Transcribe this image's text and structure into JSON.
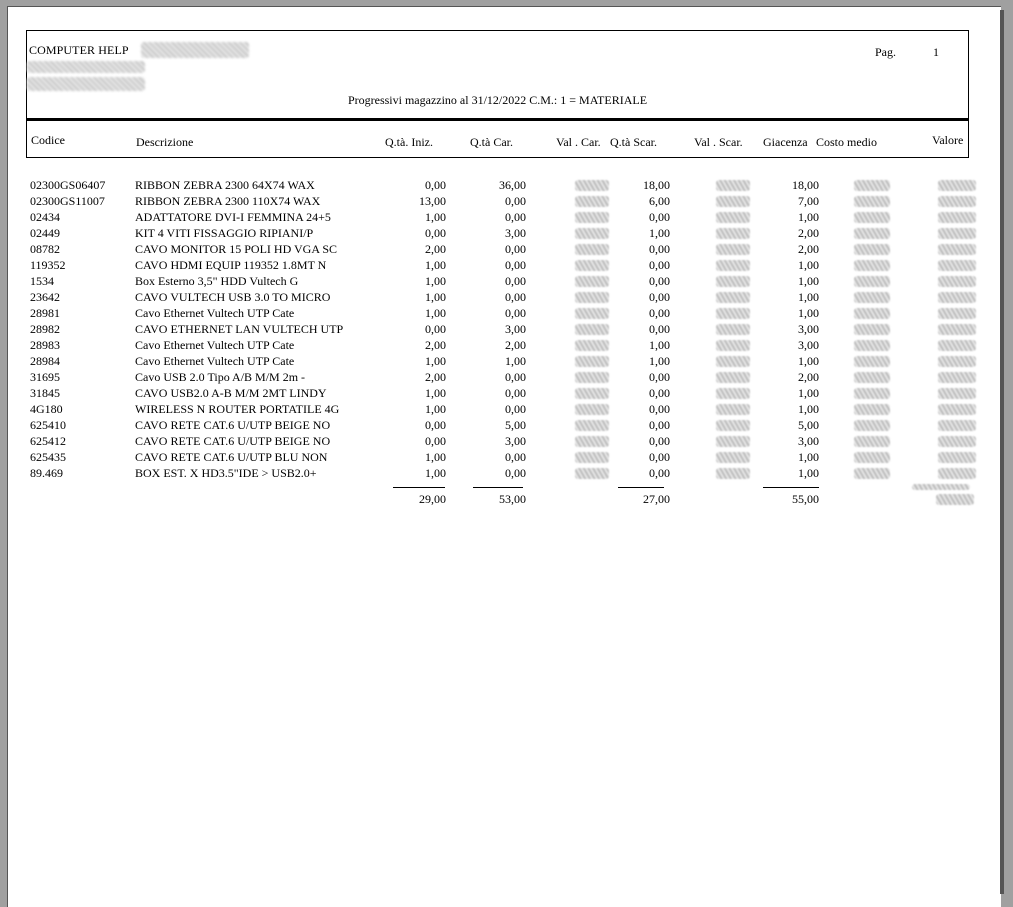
{
  "header": {
    "company": "COMPUTER HELP",
    "page_label": "Pag.",
    "page_number": "1",
    "title": "Progressivi magazzino al 31/12/2022 C.M.: 1 = MATERIALE"
  },
  "columns": {
    "codice": "Codice",
    "descrizione": "Descrizione",
    "qta_iniz": "Q.tà. Iniz.",
    "qta_car": "Q.tà Car.",
    "val_car": "Val . Car.",
    "qta_scar": "Q.tà Scar.",
    "val_scar": "Val . Scar.",
    "giacenza": "Giacenza",
    "costo_medio": "Costo medio",
    "valore": "Valore"
  },
  "rows": [
    {
      "codice": "02300GS06407",
      "descrizione": "RIBBON ZEBRA 2300 64X74 WAX",
      "qta_iniz": "0,00",
      "qta_car": "36,00",
      "qta_scar": "18,00",
      "giacenza": "18,00"
    },
    {
      "codice": "02300GS11007",
      "descrizione": "RIBBON ZEBRA 2300 110X74 WAX",
      "qta_iniz": "13,00",
      "qta_car": "0,00",
      "qta_scar": "6,00",
      "giacenza": "7,00"
    },
    {
      "codice": "02434",
      "descrizione": "ADATTATORE DVI-I FEMMINA 24+5",
      "qta_iniz": "1,00",
      "qta_car": "0,00",
      "qta_scar": "0,00",
      "giacenza": "1,00"
    },
    {
      "codice": "02449",
      "descrizione": "KIT 4 VITI FISSAGGIO RIPIANI/P",
      "qta_iniz": "0,00",
      "qta_car": "3,00",
      "qta_scar": "1,00",
      "giacenza": "2,00"
    },
    {
      "codice": "08782",
      "descrizione": "CAVO MONITOR 15 POLI HD VGA SC",
      "qta_iniz": "2,00",
      "qta_car": "0,00",
      "qta_scar": "0,00",
      "giacenza": "2,00"
    },
    {
      "codice": "119352",
      "descrizione": "CAVO HDMI EQUIP 119352 1.8MT N",
      "qta_iniz": "1,00",
      "qta_car": "0,00",
      "qta_scar": "0,00",
      "giacenza": "1,00"
    },
    {
      "codice": "1534",
      "descrizione": "Box Esterno 3,5\" HDD Vultech G",
      "qta_iniz": "1,00",
      "qta_car": "0,00",
      "qta_scar": "0,00",
      "giacenza": "1,00"
    },
    {
      "codice": "23642",
      "descrizione": "CAVO VULTECH USB 3.0 TO MICRO",
      "qta_iniz": "1,00",
      "qta_car": "0,00",
      "qta_scar": "0,00",
      "giacenza": "1,00"
    },
    {
      "codice": "28981",
      "descrizione": "Cavo Ethernet Vultech UTP Cate",
      "qta_iniz": "1,00",
      "qta_car": "0,00",
      "qta_scar": "0,00",
      "giacenza": "1,00"
    },
    {
      "codice": "28982",
      "descrizione": "CAVO ETHERNET LAN VULTECH UTP",
      "qta_iniz": "0,00",
      "qta_car": "3,00",
      "qta_scar": "0,00",
      "giacenza": "3,00"
    },
    {
      "codice": "28983",
      "descrizione": "Cavo Ethernet Vultech UTP Cate",
      "qta_iniz": "2,00",
      "qta_car": "2,00",
      "qta_scar": "1,00",
      "giacenza": "3,00"
    },
    {
      "codice": "28984",
      "descrizione": "Cavo Ethernet Vultech UTP Cate",
      "qta_iniz": "1,00",
      "qta_car": "1,00",
      "qta_scar": "1,00",
      "giacenza": "1,00"
    },
    {
      "codice": "31695",
      "descrizione": "Cavo USB 2.0 Tipo A/B M/M 2m -",
      "qta_iniz": "2,00",
      "qta_car": "0,00",
      "qta_scar": "0,00",
      "giacenza": "2,00"
    },
    {
      "codice": "31845",
      "descrizione": "CAVO USB2.0 A-B M/M 2MT LINDY",
      "qta_iniz": "1,00",
      "qta_car": "0,00",
      "qta_scar": "0,00",
      "giacenza": "1,00"
    },
    {
      "codice": "4G180",
      "descrizione": "WIRELESS N ROUTER PORTATILE 4G",
      "qta_iniz": "1,00",
      "qta_car": "0,00",
      "qta_scar": "0,00",
      "giacenza": "1,00"
    },
    {
      "codice": "625410",
      "descrizione": "CAVO RETE CAT.6 U/UTP BEIGE NO",
      "qta_iniz": "0,00",
      "qta_car": "5,00",
      "qta_scar": "0,00",
      "giacenza": "5,00"
    },
    {
      "codice": "625412",
      "descrizione": "CAVO RETE CAT.6 U/UTP BEIGE NO",
      "qta_iniz": "0,00",
      "qta_car": "3,00",
      "qta_scar": "0,00",
      "giacenza": "3,00"
    },
    {
      "codice": "625435",
      "descrizione": "CAVO RETE CAT.6 U/UTP BLU NON",
      "qta_iniz": "1,00",
      "qta_car": "0,00",
      "qta_scar": "0,00",
      "giacenza": "1,00"
    },
    {
      "codice": "89.469",
      "descrizione": "BOX EST. X HD3.5\"IDE > USB2.0+",
      "qta_iniz": "1,00",
      "qta_car": "0,00",
      "qta_scar": "0,00",
      "giacenza": "1,00"
    }
  ],
  "totals": {
    "qta_iniz": "29,00",
    "qta_car": "53,00",
    "qta_scar": "27,00",
    "giacenza": "55,00"
  }
}
